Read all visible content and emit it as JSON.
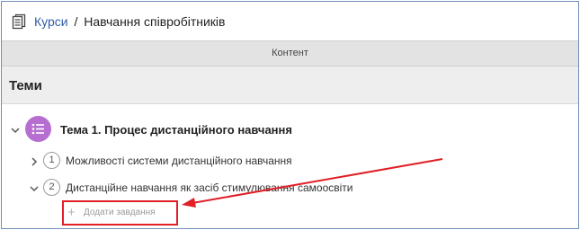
{
  "header": {
    "breadcrumb_link": "Курси",
    "separator": "/",
    "breadcrumb_current": "Навчання співробітників"
  },
  "tabs": {
    "content_label": "Контент"
  },
  "section": {
    "title": "Теми"
  },
  "topic": {
    "title": "Тема 1. Процес дистанційного навчання",
    "avatar_color": "#b66fd1",
    "icon": "list-icon"
  },
  "lessons": [
    {
      "number": "1",
      "title": "Можливості системи дистанційного навчання",
      "expanded": false
    },
    {
      "number": "2",
      "title": "Дистанційне навчання як засіб стимулювання самоосвіти",
      "expanded": true
    }
  ],
  "add_task": {
    "label": "Додати завдання"
  },
  "annotation": {
    "color": "#e01f26"
  }
}
